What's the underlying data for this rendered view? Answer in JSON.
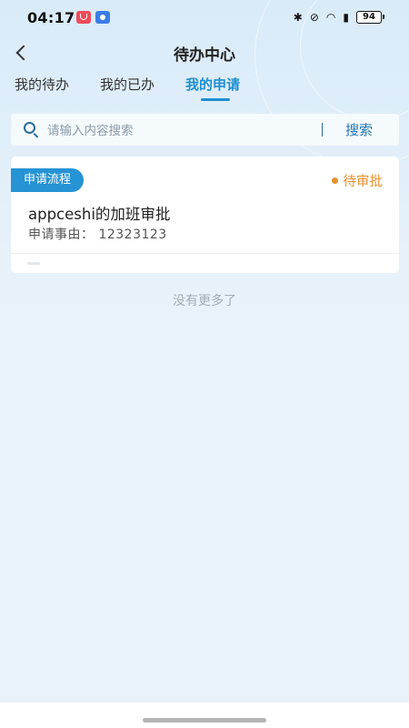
{
  "status_bar": {
    "time": "04:17",
    "battery": "94",
    "icons": [
      "red-app-icon",
      "blue-app-icon",
      "bluetooth-icon",
      "mute-icon",
      "wifi-icon",
      "alert-icon",
      "battery-icon"
    ]
  },
  "header": {
    "title": "待办中心",
    "back_icon": "chevron-left-icon"
  },
  "tabs": [
    {
      "label": "我的待办",
      "active": false
    },
    {
      "label": "我的已办",
      "active": false
    },
    {
      "label": "我的申请",
      "active": true
    }
  ],
  "search": {
    "placeholder": "请输入内容搜索",
    "value": "",
    "button_label": "搜索",
    "icon": "search-icon"
  },
  "cards": [
    {
      "tag": "申请流程",
      "status": "待审批",
      "title": "appceshi的加班审批",
      "reason_label": "申请事由：",
      "reason_value": "12323123",
      "reason_text": "申请事由：  12323123"
    }
  ],
  "list_end_text": "没有更多了",
  "colors": {
    "accent": "#1f8fce",
    "tag_bg": "#2593d4",
    "pending_status": "#e8912d",
    "background": "#e6f1fa"
  }
}
